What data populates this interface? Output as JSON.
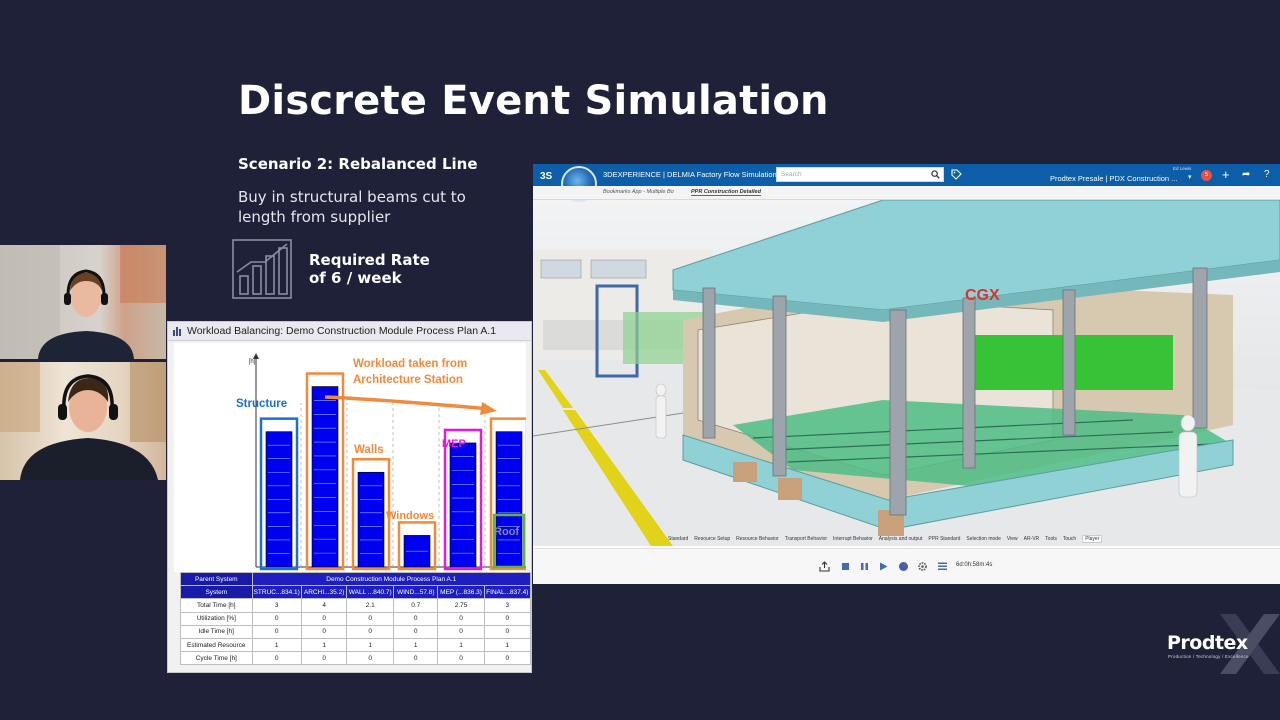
{
  "slide": {
    "title": "Discrete Event Simulation",
    "scenario_title": "Scenario 2: Rebalanced Line",
    "scenario_desc": "Buy in structural beams cut to length from supplier",
    "rate_line1": "Required Rate",
    "rate_line2": "of 6 / week"
  },
  "colors": {
    "background": "#1f2139",
    "bar_blue": "#0000f0",
    "annotation_orange": "#f08a3c",
    "annotation_blue": "#1a6fd1",
    "annotation_magenta": "#e21cd4",
    "annotation_green": "#5db34a",
    "app_header": "#0c5ea8"
  },
  "workload": {
    "title": "Workload Balancing: Demo Construction Module Process Plan A.1",
    "axis_unit": "[h]",
    "annotations": {
      "structure": "Structure",
      "moved": "Workload taken from Architecture Station",
      "walls": "Walls",
      "windows": "Windows",
      "mep": "MEP",
      "roof": "Roof"
    },
    "table": {
      "parent_label": "Parent System",
      "parent_value": "Demo Construction Module Process Plan A.1",
      "system_label": "System",
      "systems": [
        "STRUC...834.1)",
        "ARCHI...35.2)",
        "WALL ...840.7)",
        "WIND...57.8)",
        "MEP (...836.3)",
        "FINAL...837.4)"
      ],
      "rows": [
        {
          "label": "Total Time [h]",
          "values": [
            "3",
            "4",
            "2.1",
            "0.7",
            "2.75",
            "3"
          ]
        },
        {
          "label": "Utilization [%]",
          "values": [
            "0",
            "0",
            "0",
            "0",
            "0",
            "0"
          ]
        },
        {
          "label": "Idle Time [h]",
          "values": [
            "0",
            "0",
            "0",
            "0",
            "0",
            "0"
          ]
        },
        {
          "label": "Estimated Resource",
          "values": [
            "1",
            "1",
            "1",
            "1",
            "1",
            "1"
          ]
        },
        {
          "label": "Cycle Time [h]",
          "values": [
            "0",
            "0",
            "0",
            "0",
            "0",
            "0"
          ]
        }
      ]
    }
  },
  "chart_data": {
    "type": "bar",
    "categories": [
      "STRUC...834.1)",
      "ARCHI...35.2)",
      "WALL ...840.7)",
      "WIND...57.8)",
      "MEP (...836.3)",
      "FINAL...837.4)"
    ],
    "values": [
      3,
      4,
      2.1,
      0.7,
      2.75,
      3
    ],
    "ylabel": "[h]",
    "ylim": [
      0,
      4.3
    ],
    "grid": false,
    "legend": "none"
  },
  "app": {
    "brand": "3DEXPERIENCE | DELMIA Factory Flow Simulation",
    "search_placeholder": "Search",
    "collab_space": "Prodtex Presale | PDX Construction ...",
    "user": "Ed Lewis",
    "notifications": "5",
    "tab_bookmarks": "Bookmarks App - Multiple Bo",
    "tab_active": "PPR Construction Detailed",
    "menu": [
      "Standard",
      "Resource Setup",
      "Resource Behavior",
      "Transport Behavior",
      "Interrupt Behavior",
      "Analysis and output",
      "PPR Standard",
      "Selection mode",
      "View",
      "AR-VR",
      "Tools",
      "Touch",
      "Player"
    ],
    "player_time": "6d:0h:58m:4s"
  },
  "logo": {
    "name": "Prodtex",
    "tagline": "Production / Technology / Excellence"
  }
}
